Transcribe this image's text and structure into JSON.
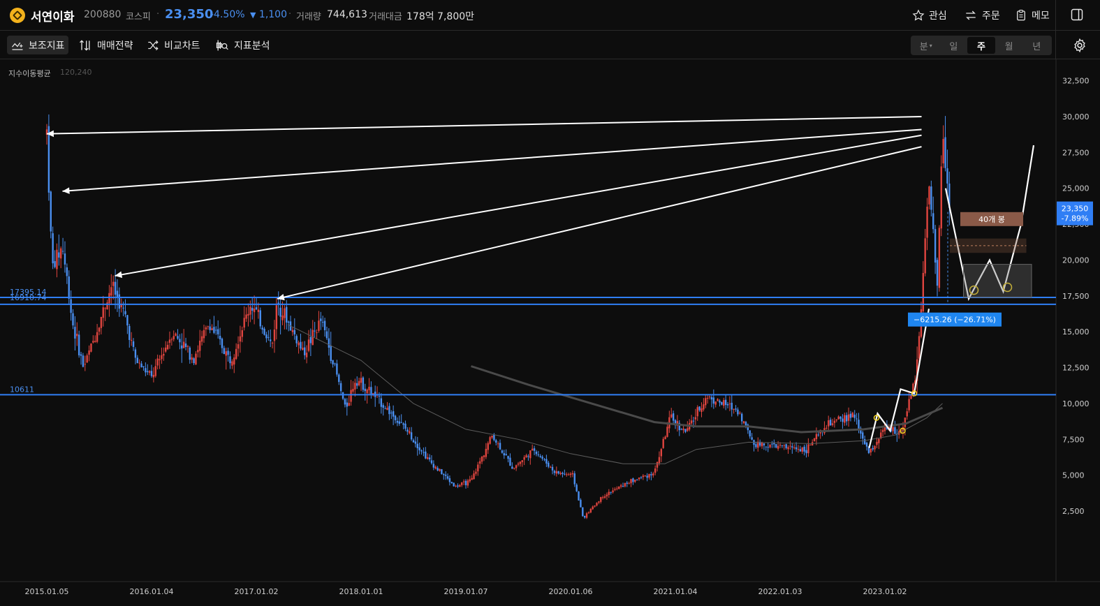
{
  "header": {
    "name": "서연이화",
    "code": "200880",
    "market": "코스피",
    "price": "23,350",
    "change_pct": "-4.50%",
    "change_abs": "1,100",
    "volume_label": "거래량",
    "volume": "744,613",
    "amount_label": "거래대금",
    "amount": "178억 7,800만",
    "watch_label": "관심",
    "order_label": "주문",
    "memo_label": "메모"
  },
  "toolbar": {
    "indicators": "보조지표",
    "strategy": "매매전략",
    "compare": "비교차트",
    "analysis": "지표분석",
    "periods": [
      "분",
      "일",
      "주",
      "월",
      "년"
    ],
    "selected_period": "주"
  },
  "indicator": {
    "label": "지수이동평균",
    "value": "120,240"
  },
  "chart_data": {
    "type": "candlestick",
    "y_ticks": [
      "32,500",
      "30,000",
      "27,500",
      "25,000",
      "22,500",
      "20,000",
      "17,500",
      "15,000",
      "12,500",
      "10,000",
      "7,500",
      "5,000",
      "2,500"
    ],
    "x_ticks": [
      "2015.01.05",
      "2016.01.04",
      "2017.01.02",
      "2018.01.01",
      "2019.01.07",
      "2020.01.06",
      "2021.01.04",
      "2022.01.03",
      "2023.01.02"
    ],
    "ylim": [
      0,
      33000
    ],
    "horizontal_lines": [
      {
        "label": "17395.14",
        "value": 17395.14
      },
      {
        "label": "16910.74",
        "value": 16910.74
      },
      {
        "label": "10611",
        "value": 10611
      }
    ],
    "current_price_label": "23,350",
    "current_change_label": "-7.89%",
    "measure_label": "−6215.26 (−26.71%)",
    "bars_label": "40개 봉",
    "colors": {
      "up": "#e0453f",
      "down": "#4a8ff0",
      "line": "#2f7ef5",
      "bg": "#0d0d0d"
    },
    "price_path": [
      [
        2015.0,
        29000
      ],
      [
        2015.05,
        19500
      ],
      [
        2015.15,
        21000
      ],
      [
        2015.25,
        15500
      ],
      [
        2015.35,
        12500
      ],
      [
        2015.45,
        14500
      ],
      [
        2015.62,
        18300
      ],
      [
        2015.75,
        16000
      ],
      [
        2015.85,
        13000
      ],
      [
        2016.0,
        11800
      ],
      [
        2016.2,
        15000
      ],
      [
        2016.4,
        13200
      ],
      [
        2016.55,
        15600
      ],
      [
        2016.75,
        13000
      ],
      [
        2016.95,
        17000
      ],
      [
        2017.15,
        14000
      ],
      [
        2017.2,
        17200
      ],
      [
        2017.45,
        13500
      ],
      [
        2017.62,
        15800
      ],
      [
        2017.75,
        12500
      ],
      [
        2017.85,
        9600
      ],
      [
        2017.95,
        11800
      ],
      [
        2018.2,
        10000
      ],
      [
        2018.45,
        8000
      ],
      [
        2018.65,
        6000
      ],
      [
        2018.9,
        4200
      ],
      [
        2019.05,
        4600
      ],
      [
        2019.25,
        7800
      ],
      [
        2019.45,
        5500
      ],
      [
        2019.65,
        6800
      ],
      [
        2019.85,
        5200
      ],
      [
        2020.02,
        5000
      ],
      [
        2020.12,
        2000
      ],
      [
        2020.3,
        3500
      ],
      [
        2020.55,
        4500
      ],
      [
        2020.8,
        5200
      ],
      [
        2020.95,
        9000
      ],
      [
        2021.1,
        8000
      ],
      [
        2021.3,
        10500
      ],
      [
        2021.6,
        9500
      ],
      [
        2021.75,
        7200
      ],
      [
        2022.0,
        7000
      ],
      [
        2022.25,
        6800
      ],
      [
        2022.45,
        8500
      ],
      [
        2022.7,
        9200
      ],
      [
        2022.85,
        6500
      ],
      [
        2023.0,
        8300
      ],
      [
        2023.15,
        8000
      ],
      [
        2023.3,
        12000
      ],
      [
        2023.42,
        25000
      ],
      [
        2023.5,
        18000
      ],
      [
        2023.55,
        29500
      ],
      [
        2023.62,
        23350
      ]
    ],
    "ema_long_path": [
      [
        2017.3,
        15500
      ],
      [
        2018.0,
        13000
      ],
      [
        2018.5,
        10000
      ],
      [
        2019.0,
        8200
      ],
      [
        2019.5,
        7500
      ],
      [
        2020.0,
        6500
      ],
      [
        2020.5,
        5800
      ],
      [
        2020.9,
        5800
      ],
      [
        2021.2,
        6800
      ],
      [
        2021.7,
        7300
      ],
      [
        2022.3,
        7200
      ],
      [
        2022.8,
        7400
      ],
      [
        2023.1,
        7800
      ],
      [
        2023.4,
        9000
      ],
      [
        2023.55,
        10000
      ]
    ],
    "ema_thick_path": [
      [
        2019.05,
        12600
      ],
      [
        2019.6,
        11300
      ],
      [
        2020.2,
        10000
      ],
      [
        2020.8,
        8700
      ],
      [
        2021.2,
        8400
      ],
      [
        2021.7,
        8400
      ],
      [
        2022.2,
        8000
      ],
      [
        2022.8,
        8200
      ],
      [
        2023.2,
        8600
      ],
      [
        2023.55,
        9700
      ]
    ],
    "projection_path": [
      [
        2023.58,
        25000
      ],
      [
        2023.8,
        17300
      ],
      [
        2024.0,
        20000
      ],
      [
        2024.13,
        17800
      ],
      [
        2024.3,
        22500
      ],
      [
        2024.42,
        28000
      ]
    ],
    "trend_path": [
      [
        2022.85,
        6900
      ],
      [
        2022.93,
        9300
      ],
      [
        2023.05,
        8100
      ],
      [
        2023.15,
        11000
      ],
      [
        2023.28,
        10700
      ],
      [
        2023.42,
        16600
      ]
    ]
  }
}
